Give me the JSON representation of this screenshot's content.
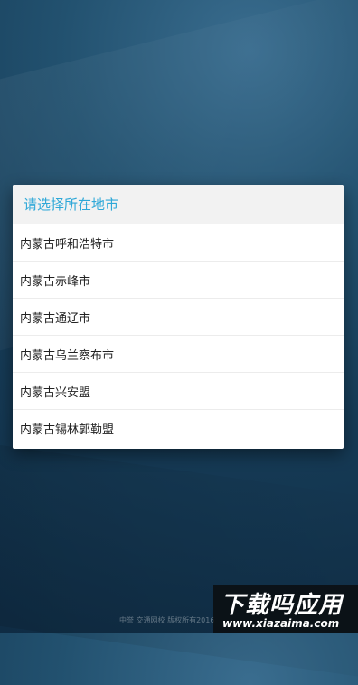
{
  "dialog": {
    "title": "请选择所在地市",
    "items": [
      {
        "label": "内蒙古呼和浩特市"
      },
      {
        "label": "内蒙古赤峰市"
      },
      {
        "label": "内蒙古通辽市"
      },
      {
        "label": "内蒙古乌兰察布市"
      },
      {
        "label": "内蒙古兴安盟"
      },
      {
        "label": "内蒙古锡林郭勒盟"
      }
    ]
  },
  "footer": {
    "copyright": "中誉 交通网校 版权所有2016"
  },
  "watermark": {
    "main": "下载吗应用",
    "url": "www.xiazaima.com"
  }
}
